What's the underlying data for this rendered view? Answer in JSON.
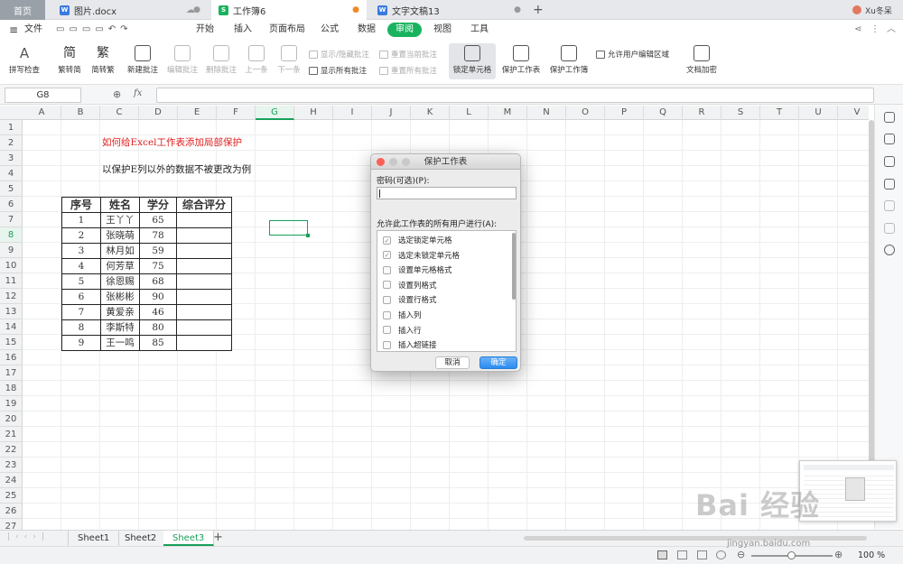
{
  "tabs": [
    {
      "label": "首页"
    },
    {
      "label": "图片.docx"
    },
    {
      "label": "工作簿6"
    },
    {
      "label": "文字文稿13"
    }
  ],
  "user": "Xu冬呆",
  "menu": {
    "file": "文件",
    "items": [
      "开始",
      "插入",
      "页面布局",
      "公式",
      "数据",
      "审阅",
      "视图",
      "工具"
    ],
    "active": "审阅"
  },
  "ribbon": {
    "spell": "拼写检查",
    "trad": "繁转简",
    "simp": "简转繁",
    "newc": "新建批注",
    "editc": "编辑批注",
    "delc": "删除批注",
    "prev": "上一条",
    "next": "下一条",
    "showhide": "显示/隐藏批注",
    "showall": "显示所有批注",
    "resetcur": "重置当前批注",
    "resetall": "重置所有批注",
    "lock": "锁定单元格",
    "protsheet": "保护工作表",
    "protbook": "保护工作簿",
    "allowedit": "允许用户编辑区域",
    "encrypt": "文档加密"
  },
  "formula": {
    "namebox": "G8",
    "fx": "fx"
  },
  "columns": [
    "A",
    "B",
    "C",
    "D",
    "E",
    "F",
    "G",
    "H",
    "I",
    "J",
    "K",
    "L",
    "M",
    "N",
    "O",
    "P",
    "Q",
    "R",
    "S",
    "T",
    "U",
    "V"
  ],
  "rows": [
    "1",
    "2",
    "3",
    "4",
    "5",
    "6",
    "7",
    "8",
    "9",
    "10",
    "11",
    "12",
    "13",
    "14",
    "15",
    "16",
    "17",
    "18",
    "19",
    "20",
    "21",
    "22",
    "23",
    "24",
    "25",
    "26",
    "27"
  ],
  "sheet": {
    "title": "如何给Excel工作表添加局部保护",
    "note": "以保护E列以外的数据不被更改为例",
    "headers": [
      "序号",
      "姓名",
      "学分",
      "综合评分"
    ],
    "records": [
      [
        "1",
        "王丫丫",
        "65",
        ""
      ],
      [
        "2",
        "张晓萌",
        "78",
        ""
      ],
      [
        "3",
        "林月如",
        "59",
        ""
      ],
      [
        "4",
        "何芳草",
        "75",
        ""
      ],
      [
        "5",
        "徐恩赐",
        "68",
        ""
      ],
      [
        "6",
        "张彬彬",
        "90",
        ""
      ],
      [
        "7",
        "黄爱亲",
        "46",
        ""
      ],
      [
        "8",
        "李斯特",
        "80",
        ""
      ],
      [
        "9",
        "王一鸣",
        "85",
        ""
      ]
    ]
  },
  "sheettabs": [
    "Sheet1",
    "Sheet2",
    "Sheet3"
  ],
  "zoom": "100 %",
  "dialog": {
    "title": "保护工作表",
    "password_label": "密码(可选)(P):",
    "allow_label": "允许此工作表的所有用户进行(A):",
    "permissions": [
      {
        "label": "选定锁定单元格",
        "checked": true
      },
      {
        "label": "选定未锁定单元格",
        "checked": true
      },
      {
        "label": "设置单元格格式",
        "checked": false
      },
      {
        "label": "设置列格式",
        "checked": false
      },
      {
        "label": "设置行格式",
        "checked": false
      },
      {
        "label": "插入列",
        "checked": false
      },
      {
        "label": "插入行",
        "checked": false
      },
      {
        "label": "插入超链接",
        "checked": false
      }
    ],
    "cancel": "取消",
    "ok": "确定"
  },
  "watermark": "Bai 经验",
  "watermark_url": "jingyan.baidu.com",
  "colors": {
    "accent": "#19b35f",
    "title_red": "#e02020"
  }
}
